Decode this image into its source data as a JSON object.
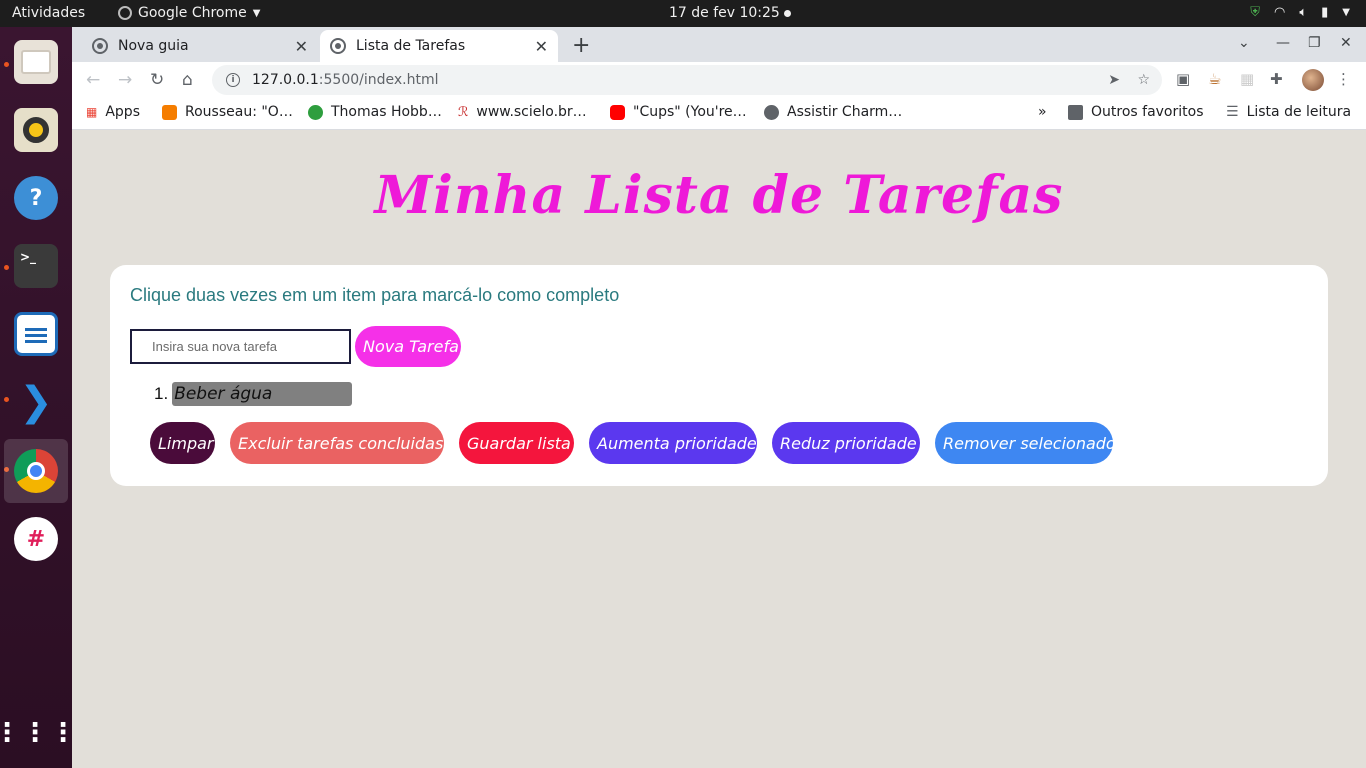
{
  "topbar": {
    "activities": "Atividades",
    "app_name": "Google Chrome",
    "clock": "17 de fev  10:25"
  },
  "dock": {
    "apps": [
      "files",
      "rhythmbox",
      "help",
      "terminal",
      "libreoffice-writer",
      "vscode",
      "chrome",
      "slack",
      "show-apps"
    ]
  },
  "browser": {
    "tabs": [
      {
        "label": "Nova guia"
      },
      {
        "label": "Lista de Tarefas"
      }
    ],
    "url_host": "127.0.0.1",
    "url_path": ":5500/index.html",
    "bookmarks": [
      {
        "label": "Apps"
      },
      {
        "label": "Rousseau: \"O…"
      },
      {
        "label": "Thomas Hobb…"
      },
      {
        "label": "www.scielo.br…"
      },
      {
        "label": "\"Cups\" (You're…"
      },
      {
        "label": "Assistir Charm…"
      }
    ],
    "bookmarks_more": "»",
    "other_bookmarks": "Outros favoritos",
    "reading_list": "Lista de leitura"
  },
  "page": {
    "title": "Minha Lista de Tarefas",
    "hint": "Clique duas vezes em um item para marcá-lo como completo",
    "input_placeholder": "Insira sua nova tarefa",
    "new_task_label": "Nova Tarefa",
    "tasks": [
      {
        "number": "1.",
        "text": "Beber água"
      }
    ],
    "buttons": {
      "clear": "Limpar",
      "delete_done": "Excluir tarefas concluidas",
      "save": "Guardar lista",
      "raise": "Aumenta prioridade",
      "lower": "Reduz prioridade",
      "remove": "Remover selecionado"
    }
  },
  "colors": {
    "title": "#ee19d8",
    "new_task": "#f530e8",
    "clear": "#4a0b3a",
    "delete_done": "#ea6262",
    "save": "#f4153d",
    "raise": "#5b38ef",
    "lower": "#5b38ef",
    "remove": "#3e87f2",
    "hint": "#2a7a7f"
  }
}
